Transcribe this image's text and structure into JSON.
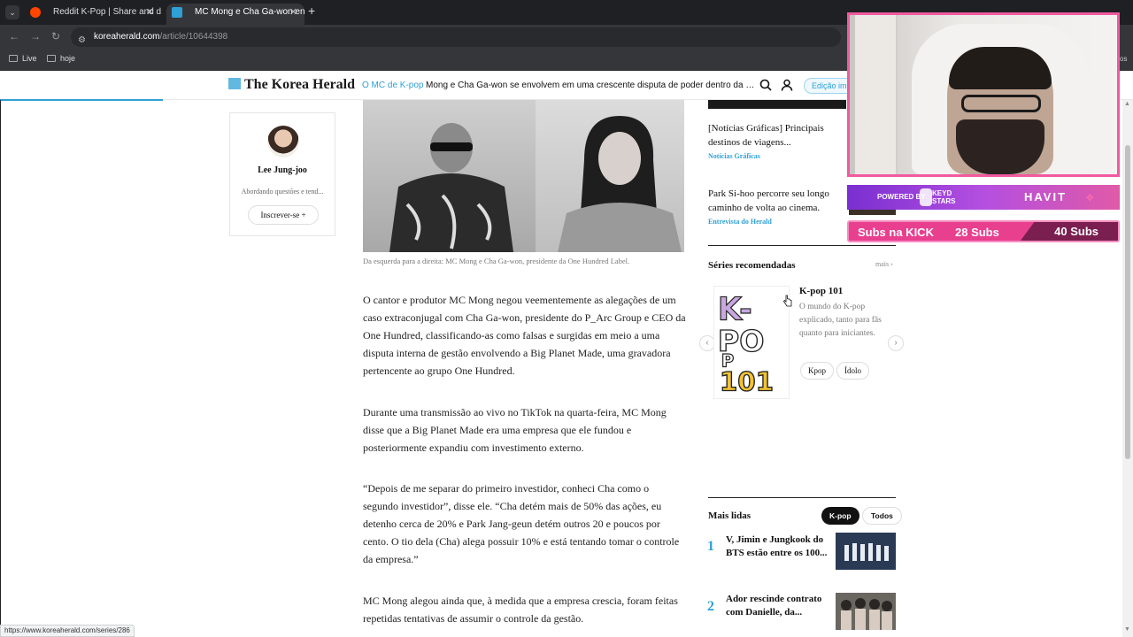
{
  "browser": {
    "tabs": [
      {
        "title": "Reddit K-Pop | Share and disco",
        "active": false
      },
      {
        "title": "MC Mong e Cha Ga-won envolv",
        "active": true
      }
    ],
    "url_host": "koreaherald.com",
    "url_path": "/article/10644398",
    "bookmarks": [
      "Live",
      "hoje"
    ],
    "status_url": "https://www.koreaherald.com/series/286"
  },
  "header": {
    "logo": "The Korea Herald",
    "section": "O MC de K-pop",
    "article_title": "Mong e Cha Ga-won se envolvem em uma crescente disputa de poder dentro da empres...",
    "edition_btn": "Edição imp"
  },
  "author": {
    "name": "Lee Jung-joo",
    "desc": "Abordando questões e tend...",
    "subscribe": "Inscrever-se +"
  },
  "article": {
    "caption": "Da esquerda para a direita: MC Mong e Cha Ga-won, presidente da One Hundred Label.",
    "paragraphs": [
      "O cantor e produtor MC Mong negou veementemente as alegações de um caso extraconjugal com Cha Ga-won, presidente do P_Arc Group e CEO da One Hundred, classificando-as como falsas e surgidas em meio a uma disputa interna de gestão envolvendo a Big Planet Made, uma gravadora pertencente ao grupo One Hundred.",
      "Durante uma transmissão ao vivo no TikTok na quarta-feira, MC Mong disse que a Big Planet Made era uma empresa que ele fundou e posteriormente expandiu com investimento externo.",
      "“Depois de me separar do primeiro investidor, conheci Cha como o segundo investidor”, disse ele. “Cha detém mais de 50% das ações, eu detenho cerca de 20% e Park Jang-geun detém outros 20 e poucos por cento. O tio dela (Cha) alega possuir 10% e está tentando tomar o controle da empresa.”",
      "MC Mong alegou ainda que, à medida que a empresa crescia, foram feitas repetidas tentativas de assumir o controle da gestão."
    ]
  },
  "sidebar": {
    "stories": [
      {
        "title": "[Notícias Gráficas] Principais destinos de viagens...",
        "category": "Notícias Gráficas"
      },
      {
        "title": "Park Si-hoo percorre seu longo caminho de volta ao cinema.",
        "category": "Entrevista do Herald"
      }
    ],
    "series_header": "Séries recomendadas",
    "more": "mais",
    "series": {
      "title": "K-pop 101",
      "desc": "O mundo do K-pop explicado, tanto para fãs quanto para iniciantes.",
      "tags": [
        "Kpop",
        "Ídolo"
      ],
      "image_text": "K-POP 101"
    },
    "most_read_header": "Mais lidas",
    "tabs": [
      "K-pop",
      "Todos"
    ],
    "most_read": [
      {
        "rank": "1",
        "title": "V, Jimin e Jungkook do BTS estão entre os 100..."
      },
      {
        "rank": "2",
        "title": "Ador rescinde contrato com Danielle, da..."
      }
    ]
  },
  "overlay": {
    "powered_by": "POWERED BY",
    "keyd": "KEYD STARS",
    "havit": "HAVIT",
    "subs_label": "Subs na KICK",
    "subs_count": "28 Subs",
    "subs_goal": "40 Subs"
  },
  "colors": {
    "accent": "#2ea0d6",
    "overlay_pink": "#e83f8f"
  }
}
